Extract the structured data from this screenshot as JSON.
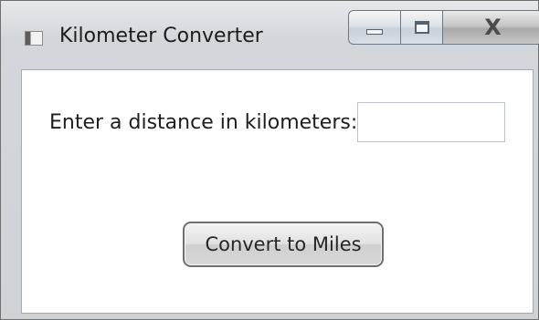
{
  "window": {
    "title": "Kilometer Converter",
    "controls": {
      "minimize": "minimize-icon",
      "maximize": "maximize-icon",
      "close": "X"
    }
  },
  "form": {
    "prompt_label": "Enter a distance in kilometers:",
    "km_value": "",
    "km_placeholder": "",
    "convert_label": "Convert to Miles"
  }
}
